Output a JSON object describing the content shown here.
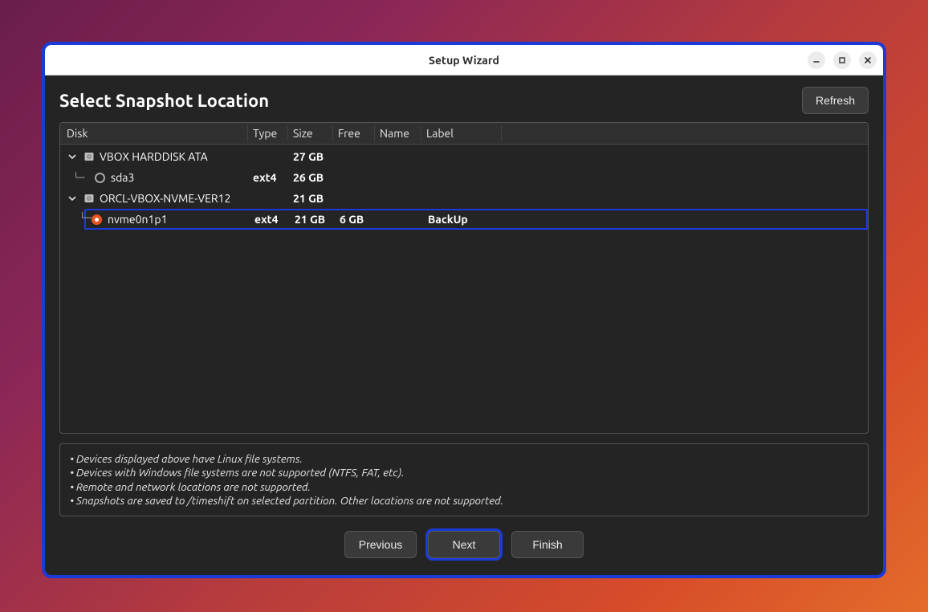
{
  "window": {
    "title": "Setup Wizard"
  },
  "header": {
    "title": "Select Snapshot Location",
    "refresh_label": "Refresh"
  },
  "columns": {
    "disk": "Disk",
    "type": "Type",
    "size": "Size",
    "free": "Free",
    "name": "Name",
    "label": "Label"
  },
  "rows": {
    "d0": {
      "disk": "VBOX HARDDISK ATA",
      "type": "",
      "size": "27 GB",
      "free": "",
      "name": "",
      "label": ""
    },
    "d0p0": {
      "disk": "sda3",
      "type": "ext4",
      "size": "26 GB",
      "free": "",
      "name": "",
      "label": ""
    },
    "d1": {
      "disk": "ORCL-VBOX-NVME-VER12",
      "type": "",
      "size": "21 GB",
      "free": "",
      "name": "",
      "label": ""
    },
    "d1p0": {
      "disk": "nvme0n1p1",
      "type": "ext4",
      "size": "21 GB",
      "free": "6 GB",
      "name": "",
      "label": "BackUp"
    }
  },
  "notes": {
    "l1": "• Devices displayed above have Linux file systems.",
    "l2": "• Devices with Windows file systems are not supported (NTFS, FAT, etc).",
    "l3": "• Remote and network locations are not supported.",
    "l4": "• Snapshots are saved to /timeshift on selected partition. Other locations are not supported."
  },
  "footer": {
    "previous": "Previous",
    "next": "Next",
    "finish": "Finish"
  }
}
